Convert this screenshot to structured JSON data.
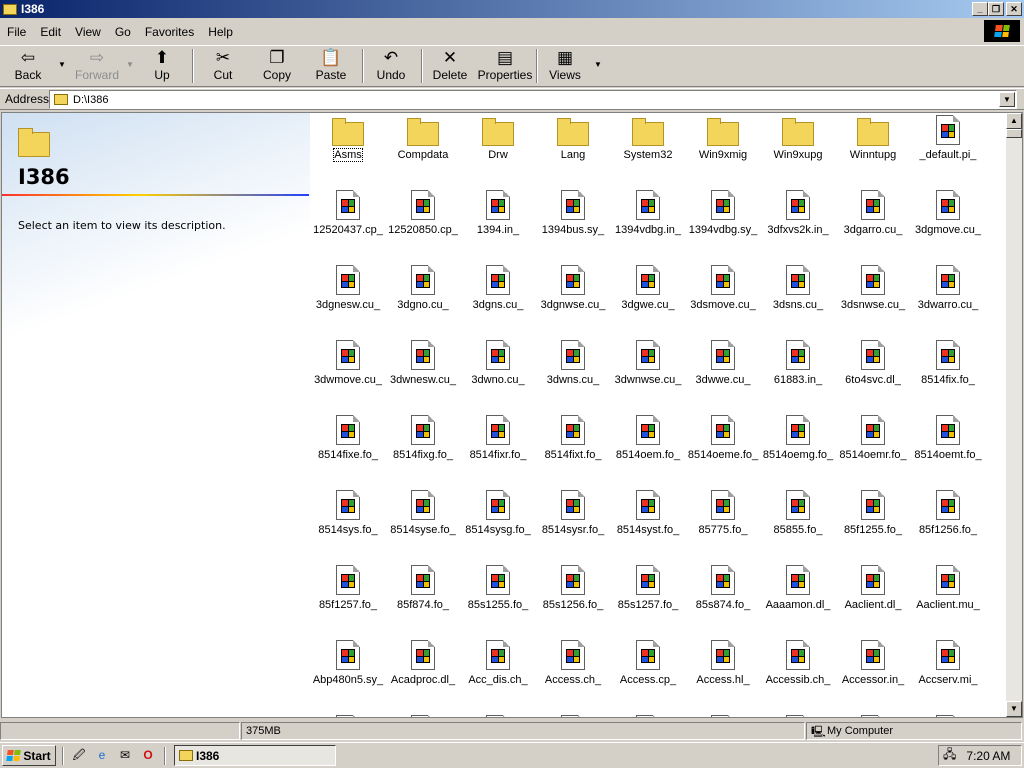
{
  "window": {
    "title": "I386",
    "minimize_glyph": "_",
    "maximize_glyph": "❐",
    "close_glyph": "✕"
  },
  "menu": [
    "File",
    "Edit",
    "View",
    "Go",
    "Favorites",
    "Help"
  ],
  "toolbar": {
    "back": "Back",
    "forward": "Forward",
    "up": "Up",
    "cut": "Cut",
    "copy": "Copy",
    "paste": "Paste",
    "undo": "Undo",
    "delete": "Delete",
    "properties": "Properties",
    "views": "Views"
  },
  "address": {
    "label": "Address",
    "value": "D:\\I386"
  },
  "webview": {
    "folder_title": "I386",
    "description": "Select an item to view its description."
  },
  "items": [
    {
      "name": "Asms",
      "type": "folder"
    },
    {
      "name": "Compdata",
      "type": "folder"
    },
    {
      "name": "Drw",
      "type": "folder"
    },
    {
      "name": "Lang",
      "type": "folder"
    },
    {
      "name": "System32",
      "type": "folder"
    },
    {
      "name": "Win9xmig",
      "type": "folder"
    },
    {
      "name": "Win9xupg",
      "type": "folder"
    },
    {
      "name": "Winntupg",
      "type": "folder"
    },
    {
      "name": "_default.pi_",
      "type": "file"
    },
    {
      "name": "12520437.cp_",
      "type": "file"
    },
    {
      "name": "12520850.cp_",
      "type": "file"
    },
    {
      "name": "1394.in_",
      "type": "file"
    },
    {
      "name": "1394bus.sy_",
      "type": "file"
    },
    {
      "name": "1394vdbg.in_",
      "type": "file"
    },
    {
      "name": "1394vdbg.sy_",
      "type": "file"
    },
    {
      "name": "3dfxvs2k.in_",
      "type": "file"
    },
    {
      "name": "3dgarro.cu_",
      "type": "file"
    },
    {
      "name": "3dgmove.cu_",
      "type": "file"
    },
    {
      "name": "3dgnesw.cu_",
      "type": "file"
    },
    {
      "name": "3dgno.cu_",
      "type": "file"
    },
    {
      "name": "3dgns.cu_",
      "type": "file"
    },
    {
      "name": "3dgnwse.cu_",
      "type": "file"
    },
    {
      "name": "3dgwe.cu_",
      "type": "file"
    },
    {
      "name": "3dsmove.cu_",
      "type": "file"
    },
    {
      "name": "3dsns.cu_",
      "type": "file"
    },
    {
      "name": "3dsnwse.cu_",
      "type": "file"
    },
    {
      "name": "3dwarro.cu_",
      "type": "file"
    },
    {
      "name": "3dwmove.cu_",
      "type": "file"
    },
    {
      "name": "3dwnesw.cu_",
      "type": "file"
    },
    {
      "name": "3dwno.cu_",
      "type": "file"
    },
    {
      "name": "3dwns.cu_",
      "type": "file"
    },
    {
      "name": "3dwnwse.cu_",
      "type": "file"
    },
    {
      "name": "3dwwe.cu_",
      "type": "file"
    },
    {
      "name": "61883.in_",
      "type": "file"
    },
    {
      "name": "6to4svc.dl_",
      "type": "file"
    },
    {
      "name": "8514fix.fo_",
      "type": "file"
    },
    {
      "name": "8514fixe.fo_",
      "type": "file"
    },
    {
      "name": "8514fixg.fo_",
      "type": "file"
    },
    {
      "name": "8514fixr.fo_",
      "type": "file"
    },
    {
      "name": "8514fixt.fo_",
      "type": "file"
    },
    {
      "name": "8514oem.fo_",
      "type": "file"
    },
    {
      "name": "8514oeme.fo_",
      "type": "file"
    },
    {
      "name": "8514oemg.fo_",
      "type": "file"
    },
    {
      "name": "8514oemr.fo_",
      "type": "file"
    },
    {
      "name": "8514oemt.fo_",
      "type": "file"
    },
    {
      "name": "8514sys.fo_",
      "type": "file"
    },
    {
      "name": "8514syse.fo_",
      "type": "file"
    },
    {
      "name": "8514sysg.fo_",
      "type": "file"
    },
    {
      "name": "8514sysr.fo_",
      "type": "file"
    },
    {
      "name": "8514syst.fo_",
      "type": "file"
    },
    {
      "name": "85775.fo_",
      "type": "file"
    },
    {
      "name": "85855.fo_",
      "type": "file"
    },
    {
      "name": "85f1255.fo_",
      "type": "file"
    },
    {
      "name": "85f1256.fo_",
      "type": "file"
    },
    {
      "name": "85f1257.fo_",
      "type": "file"
    },
    {
      "name": "85f874.fo_",
      "type": "file"
    },
    {
      "name": "85s1255.fo_",
      "type": "file"
    },
    {
      "name": "85s1256.fo_",
      "type": "file"
    },
    {
      "name": "85s1257.fo_",
      "type": "file"
    },
    {
      "name": "85s874.fo_",
      "type": "file"
    },
    {
      "name": "Aaaamon.dl_",
      "type": "file"
    },
    {
      "name": "Aaclient.dl_",
      "type": "file"
    },
    {
      "name": "Aaclient.mu_",
      "type": "file"
    },
    {
      "name": "Abp480n5.sy_",
      "type": "file"
    },
    {
      "name": "Acadproc.dl_",
      "type": "file"
    },
    {
      "name": "Acc_dis.ch_",
      "type": "file"
    },
    {
      "name": "Access.ch_",
      "type": "file"
    },
    {
      "name": "Access.cp_",
      "type": "file"
    },
    {
      "name": "Access.hl_",
      "type": "file"
    },
    {
      "name": "Accessib.ch_",
      "type": "file"
    },
    {
      "name": "Accessor.in_",
      "type": "file"
    },
    {
      "name": "Accserv.mi_",
      "type": "file"
    }
  ],
  "statusbar": {
    "size": "375MB",
    "zone": "My Computer"
  },
  "taskbar": {
    "start": "Start",
    "task": "I386",
    "clock": "7:20 AM"
  },
  "colors": {
    "titlebar_start": "#0a246a",
    "titlebar_end": "#a6caf0",
    "folder": "#f4d55b",
    "face": "#d4d0c8"
  }
}
